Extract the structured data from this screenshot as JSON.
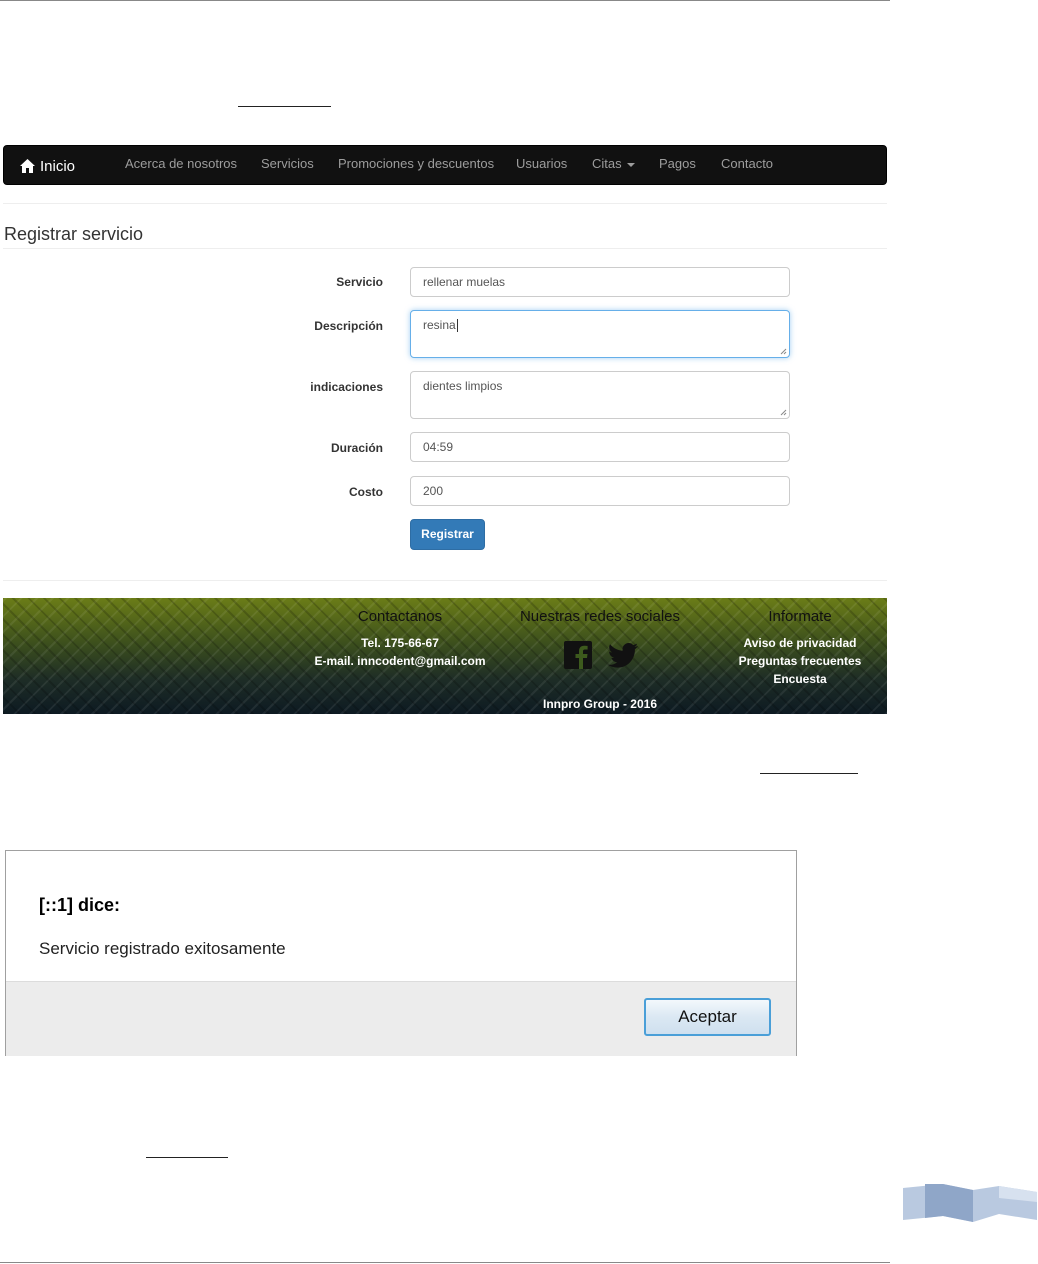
{
  "navbar": {
    "brand": "Inicio",
    "items": [
      "Acerca de nosotros",
      "Servicios",
      "Promociones y descuentos",
      "Usuarios",
      "Citas",
      "Pagos",
      "Contacto"
    ]
  },
  "form": {
    "title": "Registrar servicio",
    "fields": [
      {
        "label": "Servicio",
        "value": "rellenar muelas"
      },
      {
        "label": "Descripción",
        "value": "resina"
      },
      {
        "label": "indicaciones",
        "value": "dientes limpios"
      },
      {
        "label": "Duración",
        "value": "04:59"
      },
      {
        "label": "Costo",
        "value": "200"
      }
    ],
    "submit": "Registrar"
  },
  "footer": {
    "contact": {
      "heading": "Contactanos",
      "phone": "Tel. 175-66-67",
      "email": "E-mail. inncodent@gmail.com"
    },
    "social": {
      "heading": "Nuestras redes sociales",
      "icons": [
        "facebook-icon",
        "twitter-icon"
      ]
    },
    "info": {
      "heading": "Informate",
      "links": [
        "Aviso de privacidad",
        "Preguntas frecuentes",
        "Encuesta"
      ]
    },
    "copyright": "Innpro Group - 2016"
  },
  "dialog": {
    "title": "[::1] dice:",
    "message": "Servicio registrado exitosamente",
    "button": "Aceptar"
  },
  "colors": {
    "navbar": "#111111",
    "primary": "#337ab7",
    "focus": "#66afe9"
  }
}
